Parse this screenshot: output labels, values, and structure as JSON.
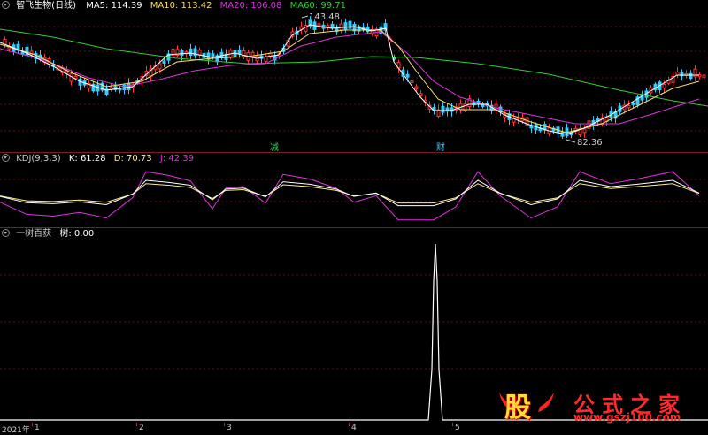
{
  "main_panel": {
    "stock_name": "智飞生物(日线)",
    "ma": [
      {
        "label": "MA5: 114.39",
        "color": "#ffffff"
      },
      {
        "label": "MA10: 113.42",
        "color": "#ffdd66"
      },
      {
        "label": "MA20: 106.08",
        "color": "#dd33dd"
      },
      {
        "label": "MA60: 99.71",
        "color": "#33cc33"
      }
    ],
    "high_label": "143.48",
    "low_label": "82.36",
    "marker_1": "减",
    "marker_2": "财"
  },
  "kdj_panel": {
    "name": "KDJ(9,3,3)",
    "k": "K: 61.28",
    "d": "D: 70.73",
    "j": "J: 42.39",
    "colors": {
      "k": "#ffffff",
      "d": "#ffee88",
      "j": "#dd33dd"
    }
  },
  "indicator_panel": {
    "name": "一树百获",
    "value": "树: 0.00"
  },
  "x_axis": {
    "labels": [
      "2021年",
      "1",
      "2",
      "3",
      "4",
      "5"
    ]
  },
  "watermark": {
    "glyph": "股",
    "name": "公式之家",
    "url": "www.gszj100.com"
  },
  "colors": {
    "up": "#ff3333",
    "down": "#33ccff",
    "separator": "#7a1e1e",
    "grid": "#5a0f0f"
  }
}
